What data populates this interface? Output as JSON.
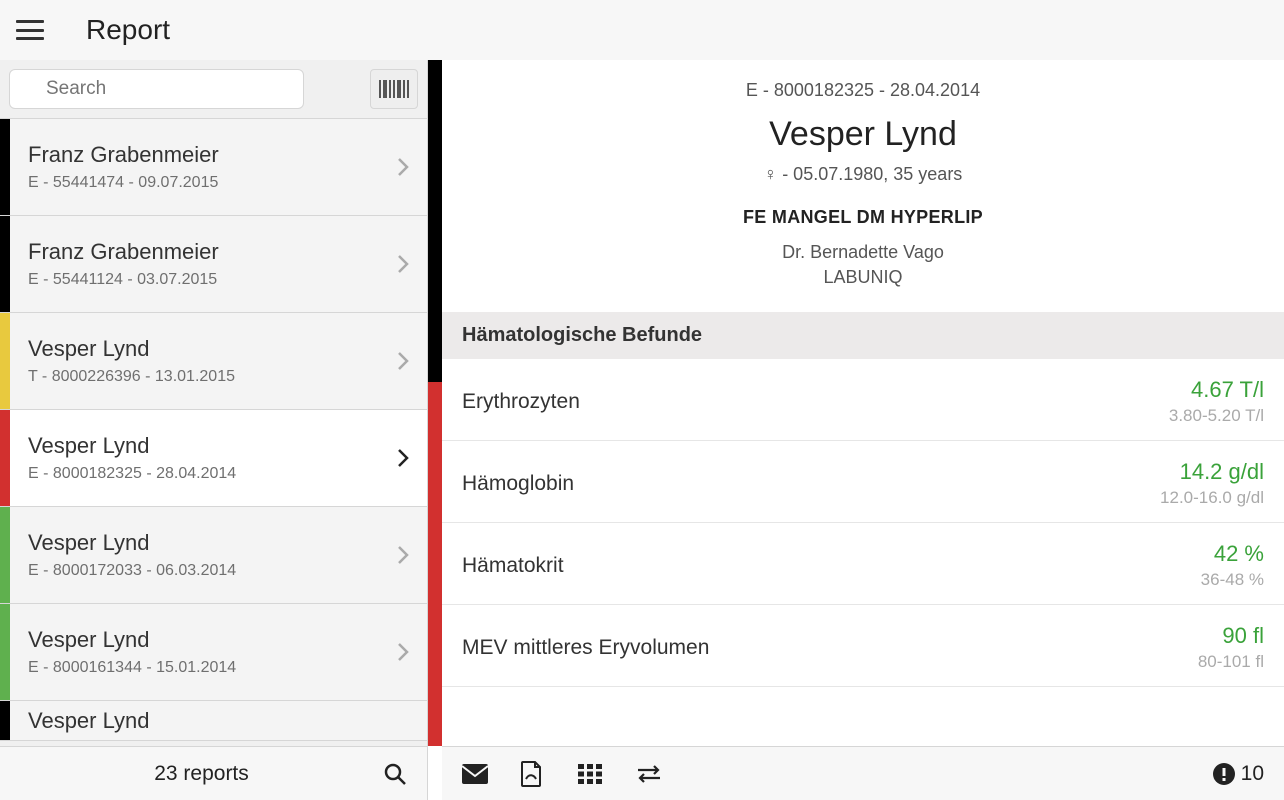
{
  "header": {
    "title": "Report"
  },
  "search": {
    "placeholder": "Search"
  },
  "sidebar": {
    "items": [
      {
        "name": "Franz Grabenmeier",
        "meta": "E - 55441474 - 09.07.2015",
        "color": "c-black"
      },
      {
        "name": "Franz Grabenmeier",
        "meta": "E - 55441124 - 03.07.2015",
        "color": "c-black"
      },
      {
        "name": "Vesper Lynd",
        "meta": "T - 8000226396 - 13.01.2015",
        "color": "c-yellow"
      },
      {
        "name": "Vesper Lynd",
        "meta": "E - 8000182325 - 28.04.2014",
        "color": "c-red",
        "selected": true
      },
      {
        "name": "Vesper Lynd",
        "meta": "E - 8000172033 - 06.03.2014",
        "color": "c-green"
      },
      {
        "name": "Vesper Lynd",
        "meta": "E - 8000161344 - 15.01.2014",
        "color": "c-green"
      },
      {
        "name": "Vesper Lynd",
        "meta": "",
        "color": "c-black",
        "partial": true
      }
    ],
    "footer_count": "23 reports"
  },
  "detail": {
    "id_line": "E - 8000182325 - 28.04.2014",
    "name": "Vesper Lynd",
    "demo": "♀ - 05.07.1980, 35 years",
    "diagnosis": "FE MANGEL DM HYPERLIP",
    "doctor": "Dr. Bernadette Vago",
    "lab": "LABUNIQ",
    "section_title": "Hämatologische Befunde",
    "results": [
      {
        "label": "Erythrozyten",
        "value": "4.67 T/l",
        "range": "3.80-5.20 T/l"
      },
      {
        "label": "Hämoglobin",
        "value": "14.2 g/dl",
        "range": "12.0-16.0 g/dl"
      },
      {
        "label": "Hämatokrit",
        "value": "42 %",
        "range": "36-48 %"
      },
      {
        "label": "MEV mittleres Eryvolumen",
        "value": "90 fl",
        "range": "80-101 fl"
      }
    ],
    "warn_count": "10"
  }
}
